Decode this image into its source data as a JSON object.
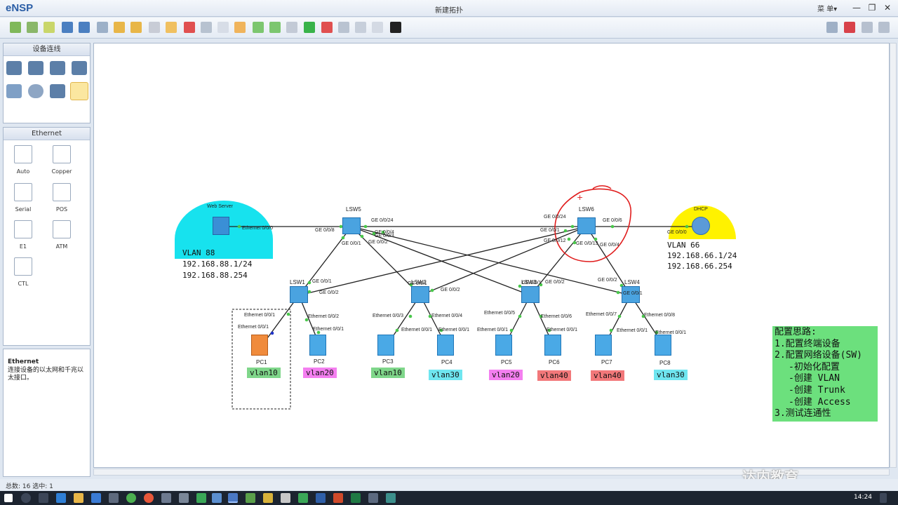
{
  "window": {
    "app_name": "eNSP",
    "title": "新建拓扑",
    "menu_label": "菜 单▾",
    "buttons": [
      "—",
      "❐",
      "✕"
    ]
  },
  "left_panel": {
    "devices_header": "设备连线",
    "ethernet_header": "Ethernet",
    "cables": [
      {
        "label": "Auto"
      },
      {
        "label": "Copper"
      },
      {
        "label": "Serial"
      },
      {
        "label": "POS"
      },
      {
        "label": "E1"
      },
      {
        "label": "ATM"
      },
      {
        "label": "CTL"
      }
    ],
    "info_title": "Ethernet",
    "info_text": "连接设备的以太网和千兆以太接口。"
  },
  "topology": {
    "web_server": {
      "name": "Web Server",
      "port": "Ethernet 0/0/0",
      "vlan": "VLAN 88",
      "ip": "192.168.88.1/24",
      "gateway": "192.168.88.254"
    },
    "dhcp": {
      "name": "DHCP",
      "port": "GE 0/0/0",
      "vlan": "VLAN 66",
      "ip": "192.168.66.1/24",
      "gateway": "192.168.66.254"
    },
    "switches": {
      "lsw5": "LSW5",
      "lsw6": "LSW6",
      "lsw1": "LSW1",
      "lsw2": "LSW2",
      "lsw3": "LSW3",
      "lsw4": "LSW4"
    },
    "port_labels": {
      "lsw5_ge24": "GE 0/0/24",
      "lsw5_ge8": "GE 0/0/8",
      "lsw5_ge4": "GE 0/0/4",
      "lsw5_ge3": "GE 0/0/3",
      "lsw5_ge1": "GE 0/0/1",
      "lsw5_ge2": "GE 0/0/2",
      "lsw6_ge24": "GE 0/0/24",
      "lsw6_ge6": "GE 0/0/6",
      "lsw6_ge1": "GE 0/0/1",
      "lsw6_ge12": "GE 0/0/12",
      "lsw6_ge13": "GE 0/0/13",
      "lsw6_ge4": "GE 0/0/4",
      "lsw1_ge1": "GE 0/0/1",
      "lsw1_ge2": "GE 0/0/2",
      "lsw1_e1": "Ethernet 0/0/1",
      "lsw1_e2": "Ethernet 0/0/2",
      "lsw2_ge1": "GE 0/0/1",
      "lsw2_ge2": "GE 0/0/2",
      "lsw2_e3": "Ethernet 0/0/3",
      "lsw2_e4": "Ethernet 0/0/4",
      "lsw3_ge1": "GE 0/0/1",
      "lsw3_ge2": "GE 0/0/2",
      "lsw3_e5": "Ethernet 0/0/5",
      "lsw3_e6": "Ethernet 0/0/6",
      "lsw4_ge1": "GE 0/0/1",
      "lsw4_ge2": "GE 0/0/2",
      "lsw4_e7": "Ethernet 0/0/7",
      "lsw4_e8": "Ethernet 0/0/8",
      "pc_eth": "Ethernet 0/0/1"
    },
    "pcs": [
      {
        "name": "PC1",
        "vlan": "vlan10",
        "color": "#7fd68a"
      },
      {
        "name": "PC2",
        "vlan": "vlan20",
        "color": "#f47ff0"
      },
      {
        "name": "PC3",
        "vlan": "vlan10",
        "color": "#7fd68a"
      },
      {
        "name": "PC4",
        "vlan": "vlan30",
        "color": "#6fe6f0"
      },
      {
        "name": "PC5",
        "vlan": "vlan20",
        "color": "#f47ff0"
      },
      {
        "name": "PC6",
        "vlan": "vlan40",
        "color": "#f2787a"
      },
      {
        "name": "PC7",
        "vlan": "vlan40",
        "color": "#f2787a"
      },
      {
        "name": "PC8",
        "vlan": "vlan30",
        "color": "#6fe6f0"
      }
    ]
  },
  "notes": {
    "title": "配置思路:",
    "lines": [
      "1.配置终端设备",
      "2.配置网络设备(SW)",
      "  -初始化配置",
      "  -创建 VLAN",
      "  -创建 Trunk",
      "  -创建 Access",
      "3.测试连通性"
    ]
  },
  "status": {
    "text": "总数: 16  选中: 1"
  },
  "taskbar": {
    "time": "14:24"
  },
  "watermark": "达内教育"
}
